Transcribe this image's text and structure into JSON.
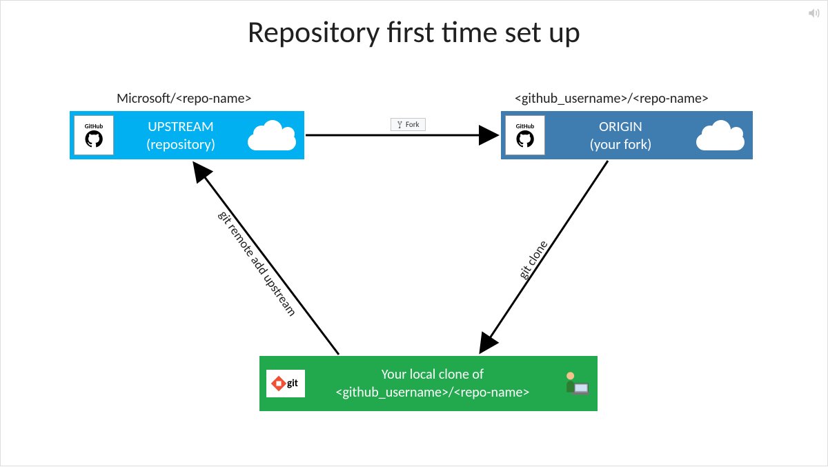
{
  "title": "Repository first time set up",
  "upstream": {
    "label_above": "Microsoft/<repo-name>",
    "line1": "UPSTREAM",
    "line2": "(repository)",
    "icon_label": "GitHub"
  },
  "origin": {
    "label_above": "<github_username>/<repo-name>",
    "line1": "ORIGIN",
    "line2": "(your fork)",
    "icon_label": "GitHub"
  },
  "local": {
    "line1": "Your local clone of",
    "line2": "<github_username>/<repo-name>",
    "git_label": "git"
  },
  "arrows": {
    "fork_label": "Fork",
    "remote_label": "git remote add upstream",
    "clone_label": "git clone"
  }
}
